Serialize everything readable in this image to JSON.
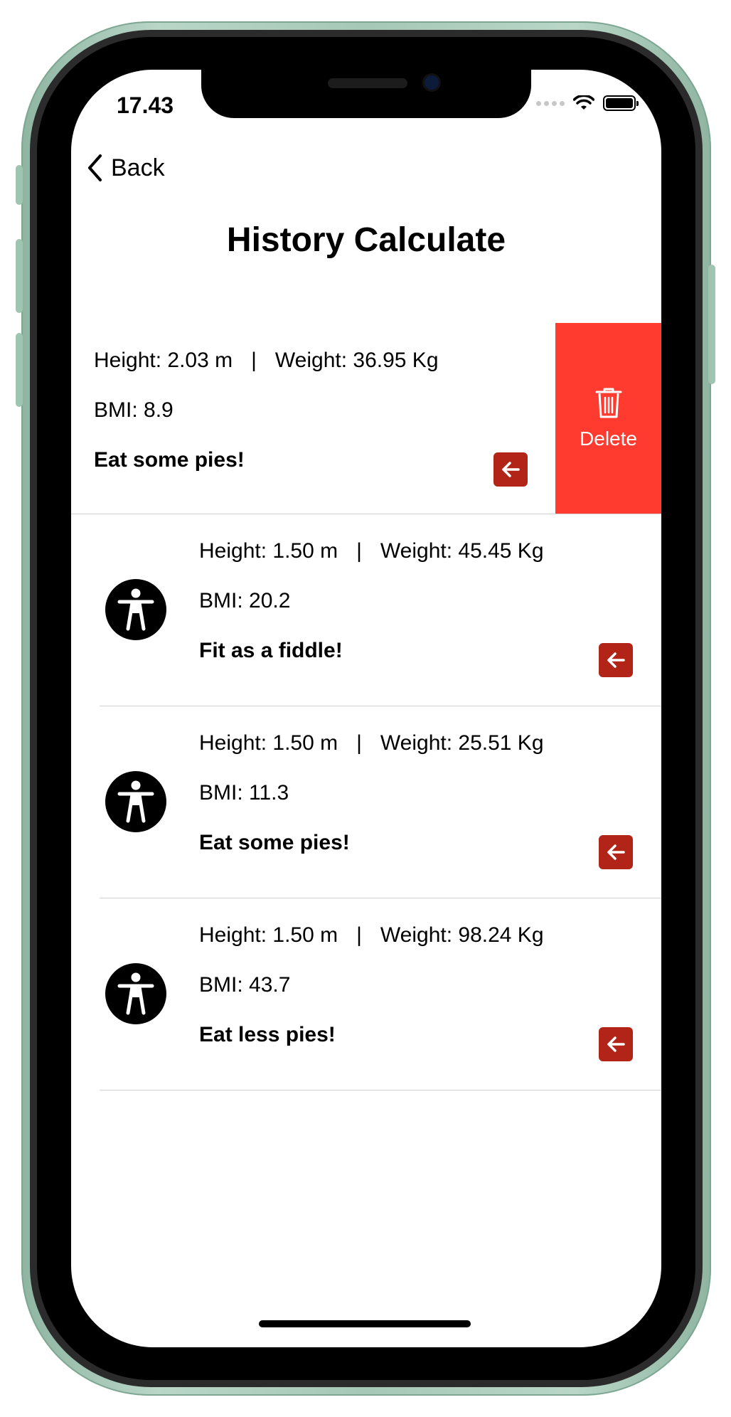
{
  "status_bar": {
    "time": "17.43"
  },
  "nav": {
    "back_label": "Back",
    "title": "History Calculate"
  },
  "delete_action": {
    "label": "Delete"
  },
  "rows": [
    {
      "height": "Height: 2.03 m",
      "weight": "Weight: 36.95 Kg",
      "bmi": "BMI: 8.9",
      "advice": "Eat some pies!"
    },
    {
      "height": "Height: 1.50 m",
      "weight": "Weight: 45.45 Kg",
      "bmi": "BMI: 20.2",
      "advice": "Fit as a fiddle!"
    },
    {
      "height": "Height: 1.50 m",
      "weight": "Weight: 25.51 Kg",
      "bmi": "BMI: 11.3",
      "advice": "Eat some pies!"
    },
    {
      "height": "Height: 1.50 m",
      "weight": "Weight: 98.24 Kg",
      "bmi": "BMI: 43.7",
      "advice": "Eat less pies!"
    }
  ],
  "separator": "|",
  "icons": {
    "back": "chevron-left-icon",
    "avatar": "accessibility-icon",
    "row_action": "arrow-left-icon",
    "delete": "trash-icon"
  },
  "colors": {
    "delete_bg": "#ff3b30",
    "action_button": "#b22417",
    "phone_frame": "#a6c8b6"
  }
}
